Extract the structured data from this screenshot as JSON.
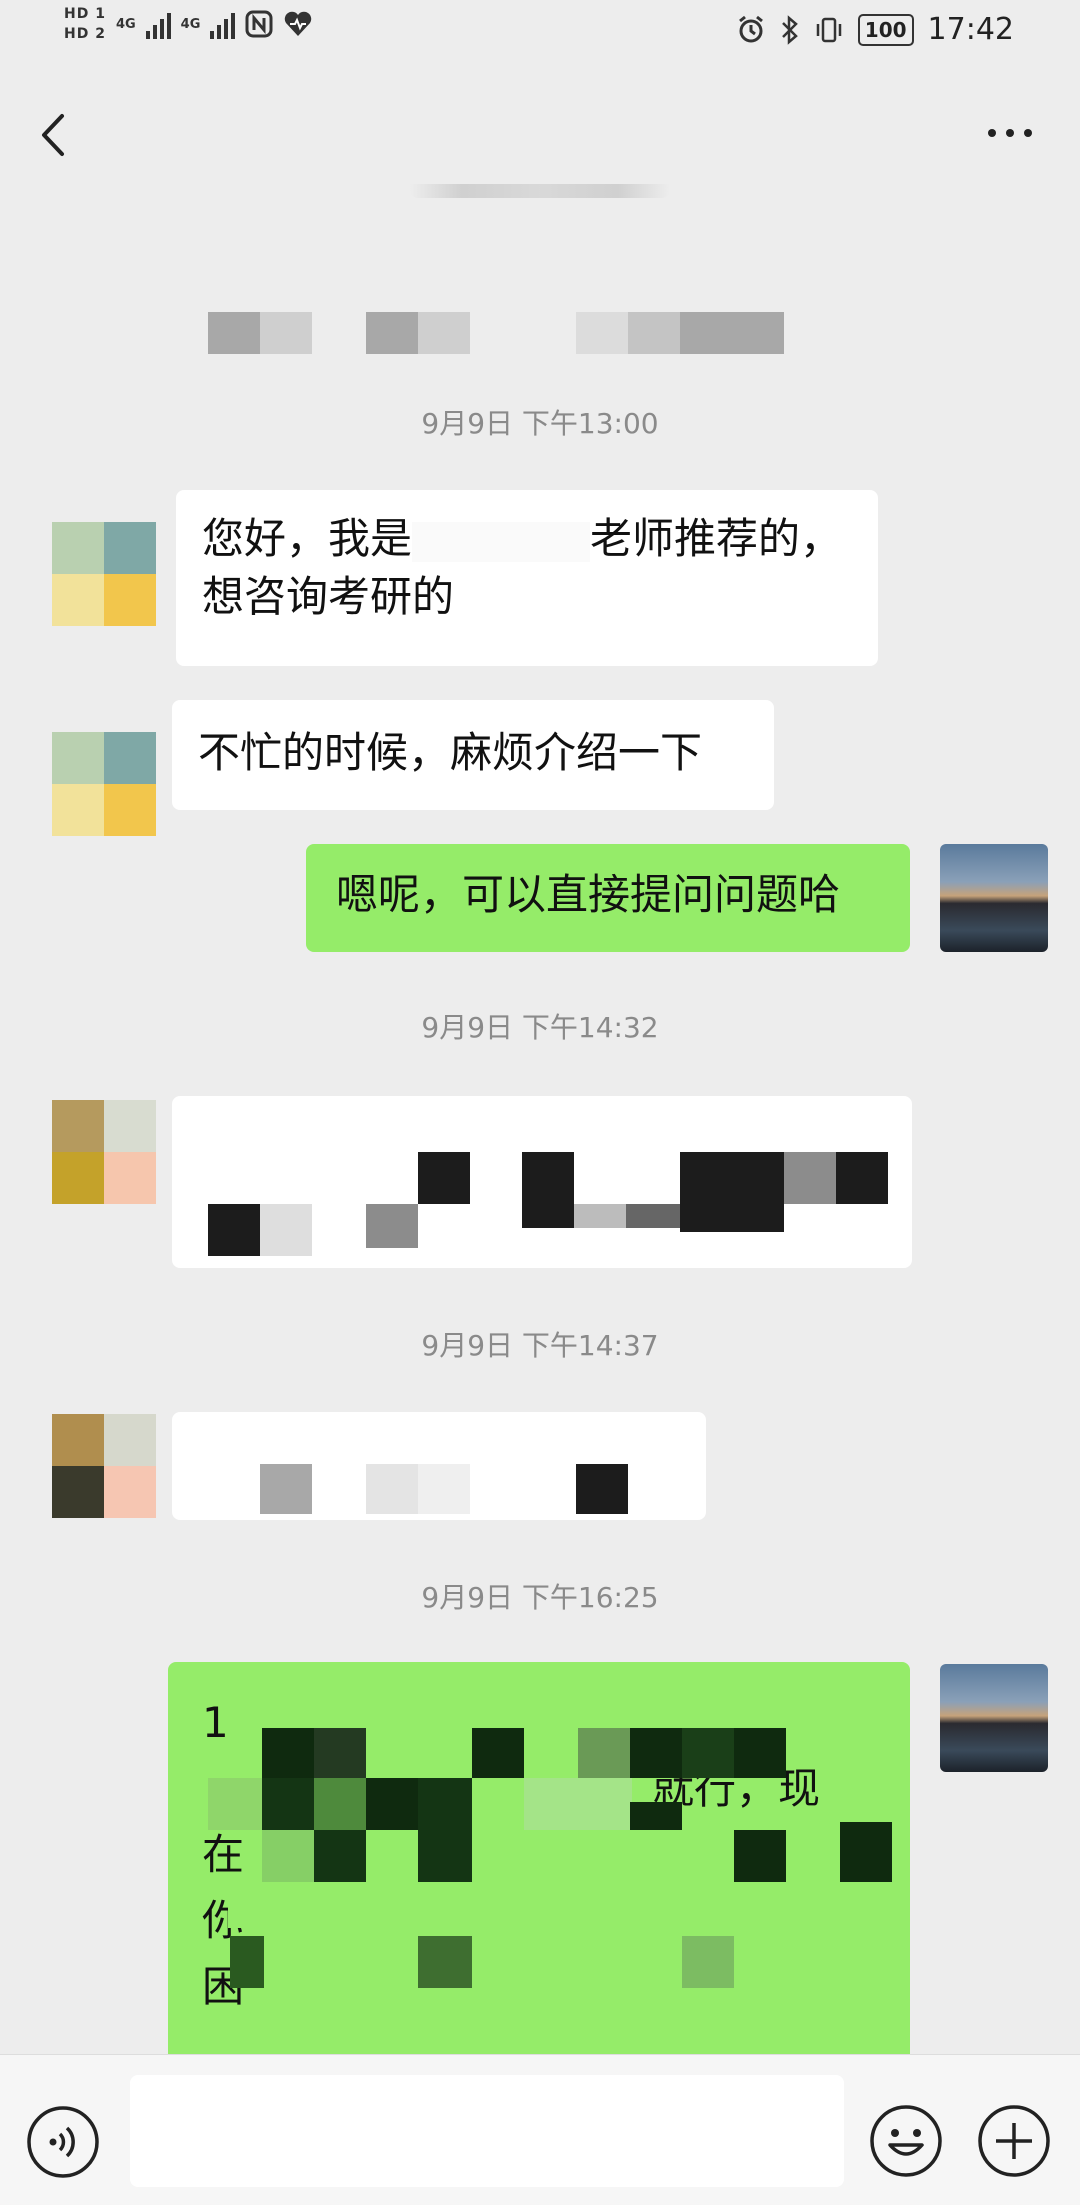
{
  "status": {
    "hd1": "HD 1",
    "hd2": "HD 2",
    "net1": "4G",
    "net2": "4G",
    "battery": "100",
    "time": "17:42"
  },
  "chat": {
    "timestamps": [
      "9月9日 下午13:00",
      "9月9日 下午14:32",
      "9月9日 下午14:37",
      "9月9日 下午16:25"
    ],
    "msg1_line1_a": "您好，我是",
    "msg1_line1_b": "老师推荐的，",
    "msg1_line2": "想咨询考研的",
    "msg2": "不忙的时候，麻烦介绍一下",
    "msg3": "嗯呢，可以直接提问问题哈",
    "msg6_tail": "就行，现",
    "msg6_lines": [
      "1",
      "在",
      "你",
      "困"
    ]
  },
  "icons": {
    "back": "chevron-left-icon",
    "more": "more-dots-icon",
    "voice": "voice-input-icon",
    "emoji": "emoji-icon",
    "plus": "plus-icon"
  },
  "colors": {
    "incoming": "#ffffff",
    "outgoing": "#95ec69",
    "background": "#ededed"
  }
}
